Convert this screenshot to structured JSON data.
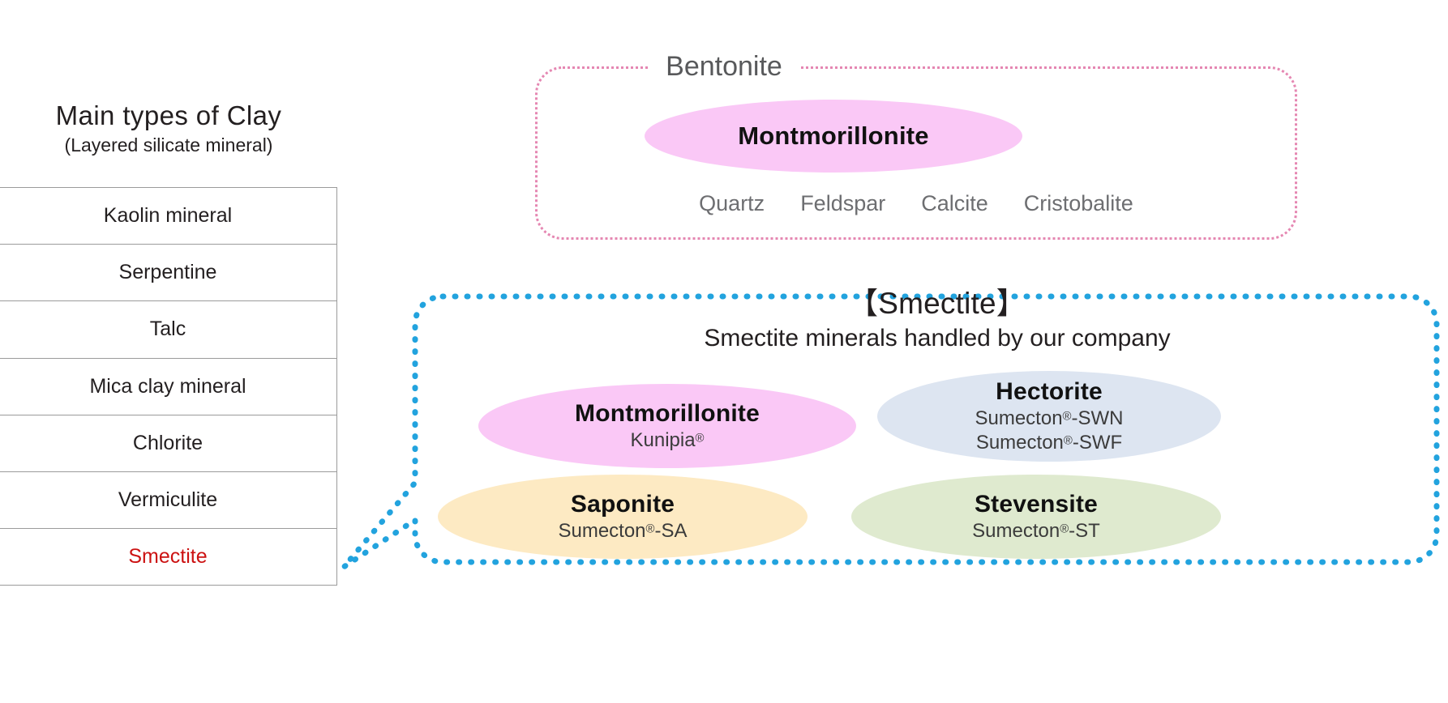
{
  "clay_panel": {
    "title": "Main types of Clay",
    "subtitle": "(Layered silicate mineral)",
    "rows": [
      {
        "label": "Kaolin mineral",
        "highlighted": false
      },
      {
        "label": "Serpentine",
        "highlighted": false
      },
      {
        "label": "Talc",
        "highlighted": false
      },
      {
        "label": "Mica clay mineral",
        "highlighted": false
      },
      {
        "label": "Chlorite",
        "highlighted": false
      },
      {
        "label": "Vermiculite",
        "highlighted": false
      },
      {
        "label": "Smectite",
        "highlighted": true
      }
    ],
    "highlight_color": "#cc1111",
    "border_color": "#9b9b9b"
  },
  "bentonite_box": {
    "label": "Bentonite",
    "border_color": "#e587b2",
    "primary_mineral": {
      "name": "Montmorillonite",
      "fill_color": "#fac8f6"
    },
    "accessory_minerals": [
      "Quartz",
      "Feldspar",
      "Calcite",
      "Cristobalite"
    ]
  },
  "smectite_callout": {
    "heading": "【Smectite】",
    "subheading": "Smectite minerals handled by our company",
    "border_color": "#22a3de",
    "minerals": [
      {
        "name": "Montmorillonite",
        "brand_lines": [
          "Kunipia®"
        ],
        "fill_color": "#fac8f6"
      },
      {
        "name": "Hectorite",
        "brand_lines": [
          "Sumecton®-SWN",
          "Sumecton®-SWF"
        ],
        "fill_color": "#dde5f1"
      },
      {
        "name": "Saponite",
        "brand_lines": [
          "Sumecton®-SA"
        ],
        "fill_color": "#fdeac3"
      },
      {
        "name": "Stevensite",
        "brand_lines": [
          "Sumecton®-ST"
        ],
        "fill_color": "#dfeacf"
      }
    ]
  }
}
